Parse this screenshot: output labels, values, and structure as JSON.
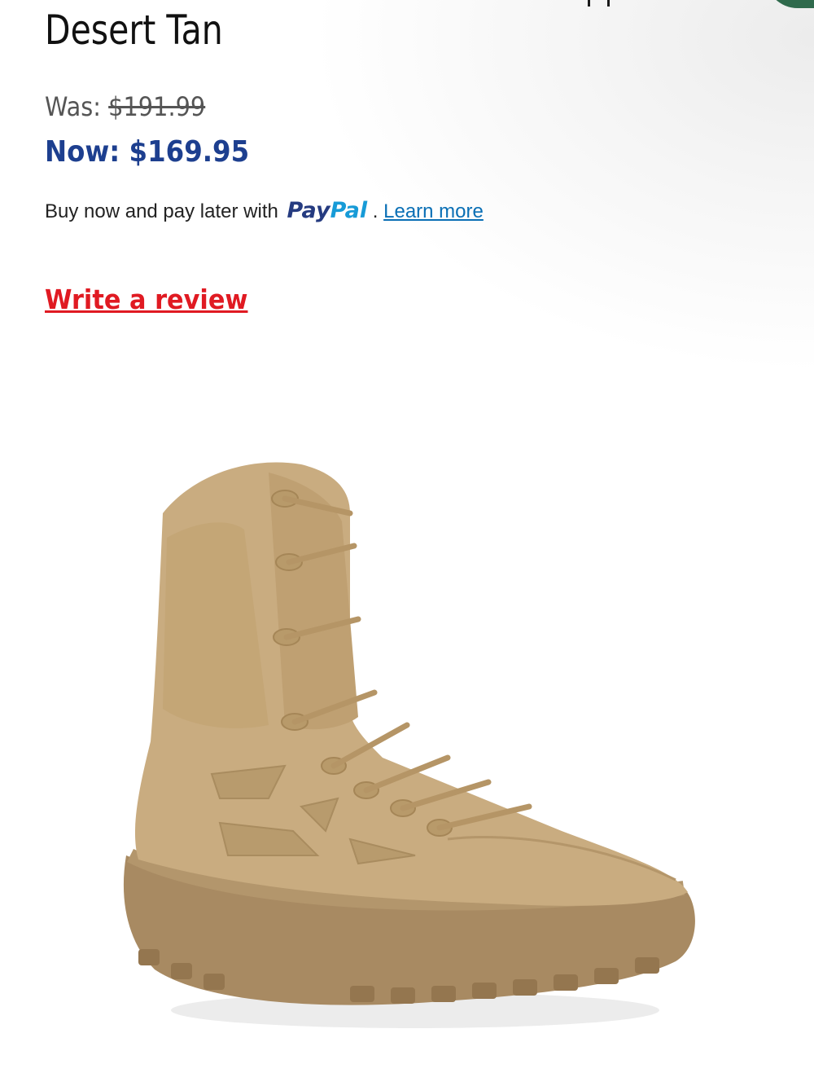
{
  "product": {
    "title": "Desert Tan",
    "was_label": "Was:",
    "was_price": "$191.99",
    "now_label": "Now:",
    "now_price": "$169.95",
    "paypal_text": "Buy now and pay later with",
    "paypal_logo_part1": "Pay",
    "paypal_logo_part2": "Pal",
    "paypal_separator": ".",
    "learn_more": "Learn more",
    "write_review": "Write a review",
    "image_icon": "tactical-boot-image"
  },
  "colors": {
    "now_price": "#1d3f8f",
    "review_link": "#e01a22",
    "learn_more": "#0a6fb5",
    "paypal_dark": "#253b80",
    "paypal_light": "#179bd7",
    "boot": "#c9ac80",
    "corner_badge": "#2f6a4c"
  }
}
